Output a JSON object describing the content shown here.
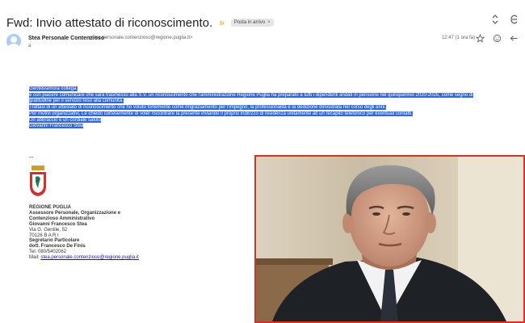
{
  "header": {
    "subject": "Fwd: Invio attestato di riconoscimento.",
    "label": "Posta in arrivo",
    "label_close": "×"
  },
  "sender": {
    "name": "Stea Personale Contenzioso",
    "email": "<stea.personale.contenzioso@regione.puglia.it>",
    "to": "a",
    "time": "12:47 (1 ora fa)"
  },
  "body": {
    "lines": [
      "Gentilissimo/a collega,",
      "è con piacere comunicare che sarà trasmesso alla S.V. un riconoscimento che l'amministrazione Regione Puglia ha preparato a tutti i dipendenti andati in pensione nel quinquennio 2020-2025, come segno di",
      "gratitudine per il servizio reso alla comunità.",
      "Trattasi di un attestato di riconoscimento che ho voluto fortemente come ringraziamento per l'impegno, la professionalità e la dedizione dimostrata nel corso degli anni.",
      "Per motivi organizzativi, Le chiedo cortesemente di voler riscontrare la presente inviando il proprio indirizzo di residenza unitamente ad un recapito telefonico per eventuali contatti.",
      "Un abbraccio e un cordiale saluto",
      "Giovanni Francesco Stea"
    ]
  },
  "signature": {
    "dash": "--",
    "org": "REGIONE PUGLIA",
    "role1": "Assessore Personale, Organizzazione e",
    "role2": "Contenzioso Amministrativo",
    "person": "Giovanni Francesco Stea",
    "street": "Via G. Gentile, 52",
    "city": "70126 B A R I",
    "secretary_title": "Segretario Particolare",
    "secretary_name": "dott. Francesco De Finis",
    "tel": "Tel. 080/5402062",
    "mail_label": "Mail: ",
    "mail": "stea.personale.contenzioso@regione.puglia.it"
  },
  "colors": {
    "highlight": "#3367d6",
    "photo_border": "#d93025",
    "important_marker": "#f2a600",
    "avatar": "#aecbfa",
    "link": "#1a0dab"
  },
  "icons": [
    "important-marker-icon",
    "expand-icon",
    "open-in-new-window-icon",
    "user-avatar-icon",
    "star-icon",
    "emoji-reaction-icon",
    "reply-icon",
    "regione-puglia-logo-icon",
    "portrait-photo"
  ]
}
